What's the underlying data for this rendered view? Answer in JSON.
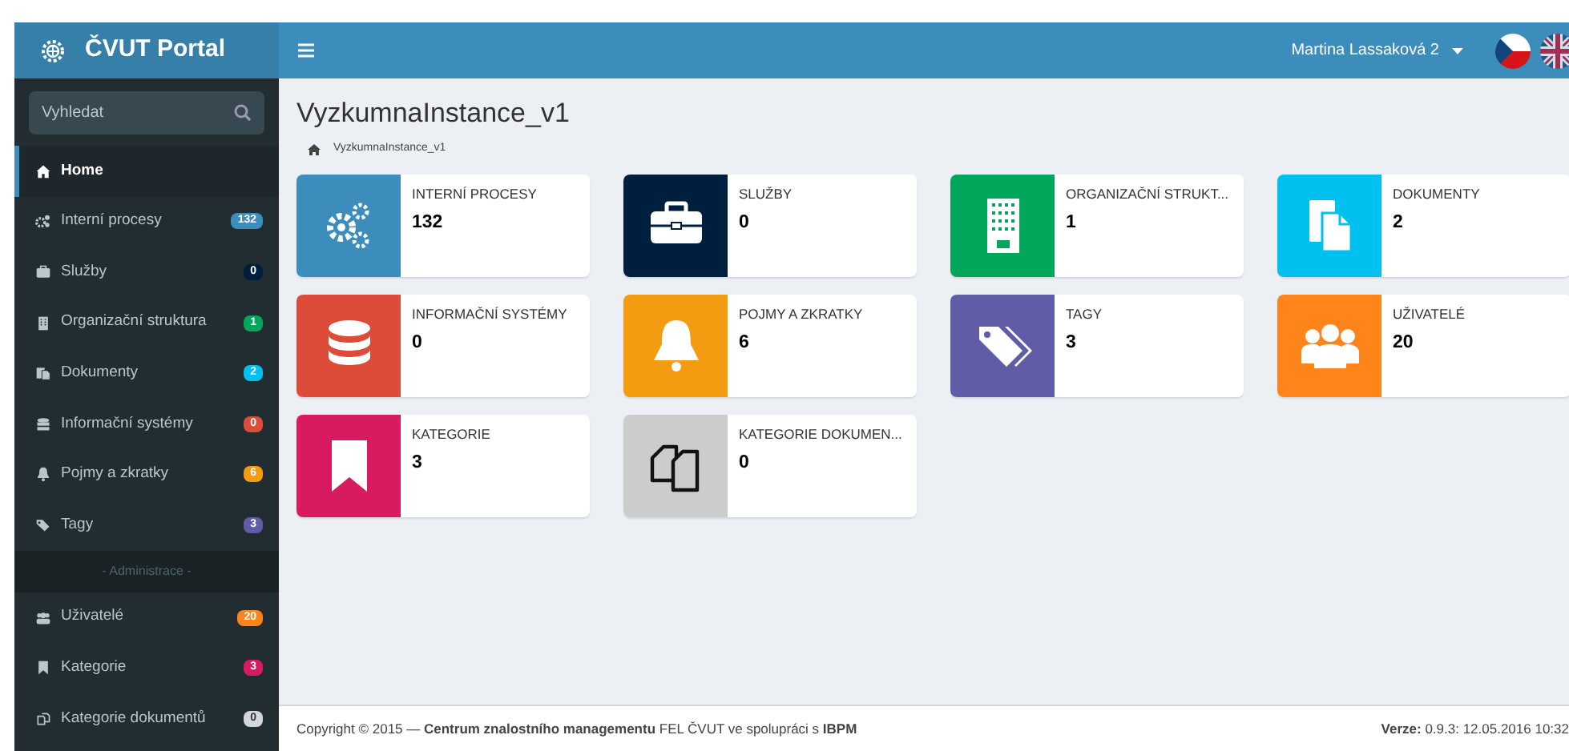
{
  "brand": {
    "title": "ČVUT Portal"
  },
  "header": {
    "user": "Martina Lassaková 2"
  },
  "search": {
    "placeholder": "Vyhledat"
  },
  "sidebar": {
    "items": [
      {
        "label": "Home",
        "selected": true
      },
      {
        "label": "Interní procesy",
        "badge": "132",
        "color": "#3c8dbc",
        "selected": false
      },
      {
        "label": "Služby",
        "badge": "0",
        "color": "#001f3f",
        "selected": false
      },
      {
        "label": "Organizační struktura",
        "badge": "1",
        "color": "#00a65a",
        "selected": false
      },
      {
        "label": "Dokumenty",
        "badge": "2",
        "color": "#00c0ef",
        "selected": false
      },
      {
        "label": "Informační systémy",
        "badge": "0",
        "color": "#dd4b39",
        "selected": false
      },
      {
        "label": "Pojmy a zkratky",
        "badge": "6",
        "color": "#f39c12",
        "selected": false
      },
      {
        "label": "Tagy",
        "badge": "3",
        "color": "#605ca8",
        "selected": false
      }
    ],
    "section": "- Administrace -",
    "admin_items": [
      {
        "label": "Uživatelé",
        "badge": "20",
        "color": "#ff851b",
        "selected": false
      },
      {
        "label": "Kategorie",
        "badge": "3",
        "color": "#d81b60",
        "selected": false
      },
      {
        "label": "Kategorie dokumentů",
        "badge": "0",
        "color": "#d2d6de",
        "selected": false
      }
    ]
  },
  "page": {
    "title": "VyzkumnaInstance_v1",
    "breadcrumb": "VyzkumnaInstance_v1"
  },
  "cards": [
    {
      "label": "INTERNÍ PROCESY",
      "count": "132",
      "color": "#3c8dbc"
    },
    {
      "label": "SLUŽBY",
      "count": "0",
      "color": "#001f3f"
    },
    {
      "label": "ORGANIZAČNÍ STRUKT...",
      "count": "1",
      "color": "#00a65a"
    },
    {
      "label": "DOKUMENTY",
      "count": "2",
      "color": "#00c0ef"
    },
    {
      "label": "INFORMAČNÍ SYSTÉMY",
      "count": "0",
      "color": "#dd4b39"
    },
    {
      "label": "POJMY A ZKRATKY",
      "count": "6",
      "color": "#f39c12"
    },
    {
      "label": "TAGY",
      "count": "3",
      "color": "#605ca8"
    },
    {
      "label": "UŽIVATELÉ",
      "count": "20",
      "color": "#ff851b"
    },
    {
      "label": "KATEGORIE",
      "count": "3",
      "color": "#d81b60"
    },
    {
      "label": "KATEGORIE DOKUMEN...",
      "count": "0",
      "color": "#cccccc"
    }
  ],
  "footer": {
    "copyright": "Copyright ©  2015 — **Centrum znalostního managementu** FEL ČVUT ve spolupráci s **IBPM**",
    "version": "**Verze:** 0.9.3: 12.05.2016 10:32"
  }
}
